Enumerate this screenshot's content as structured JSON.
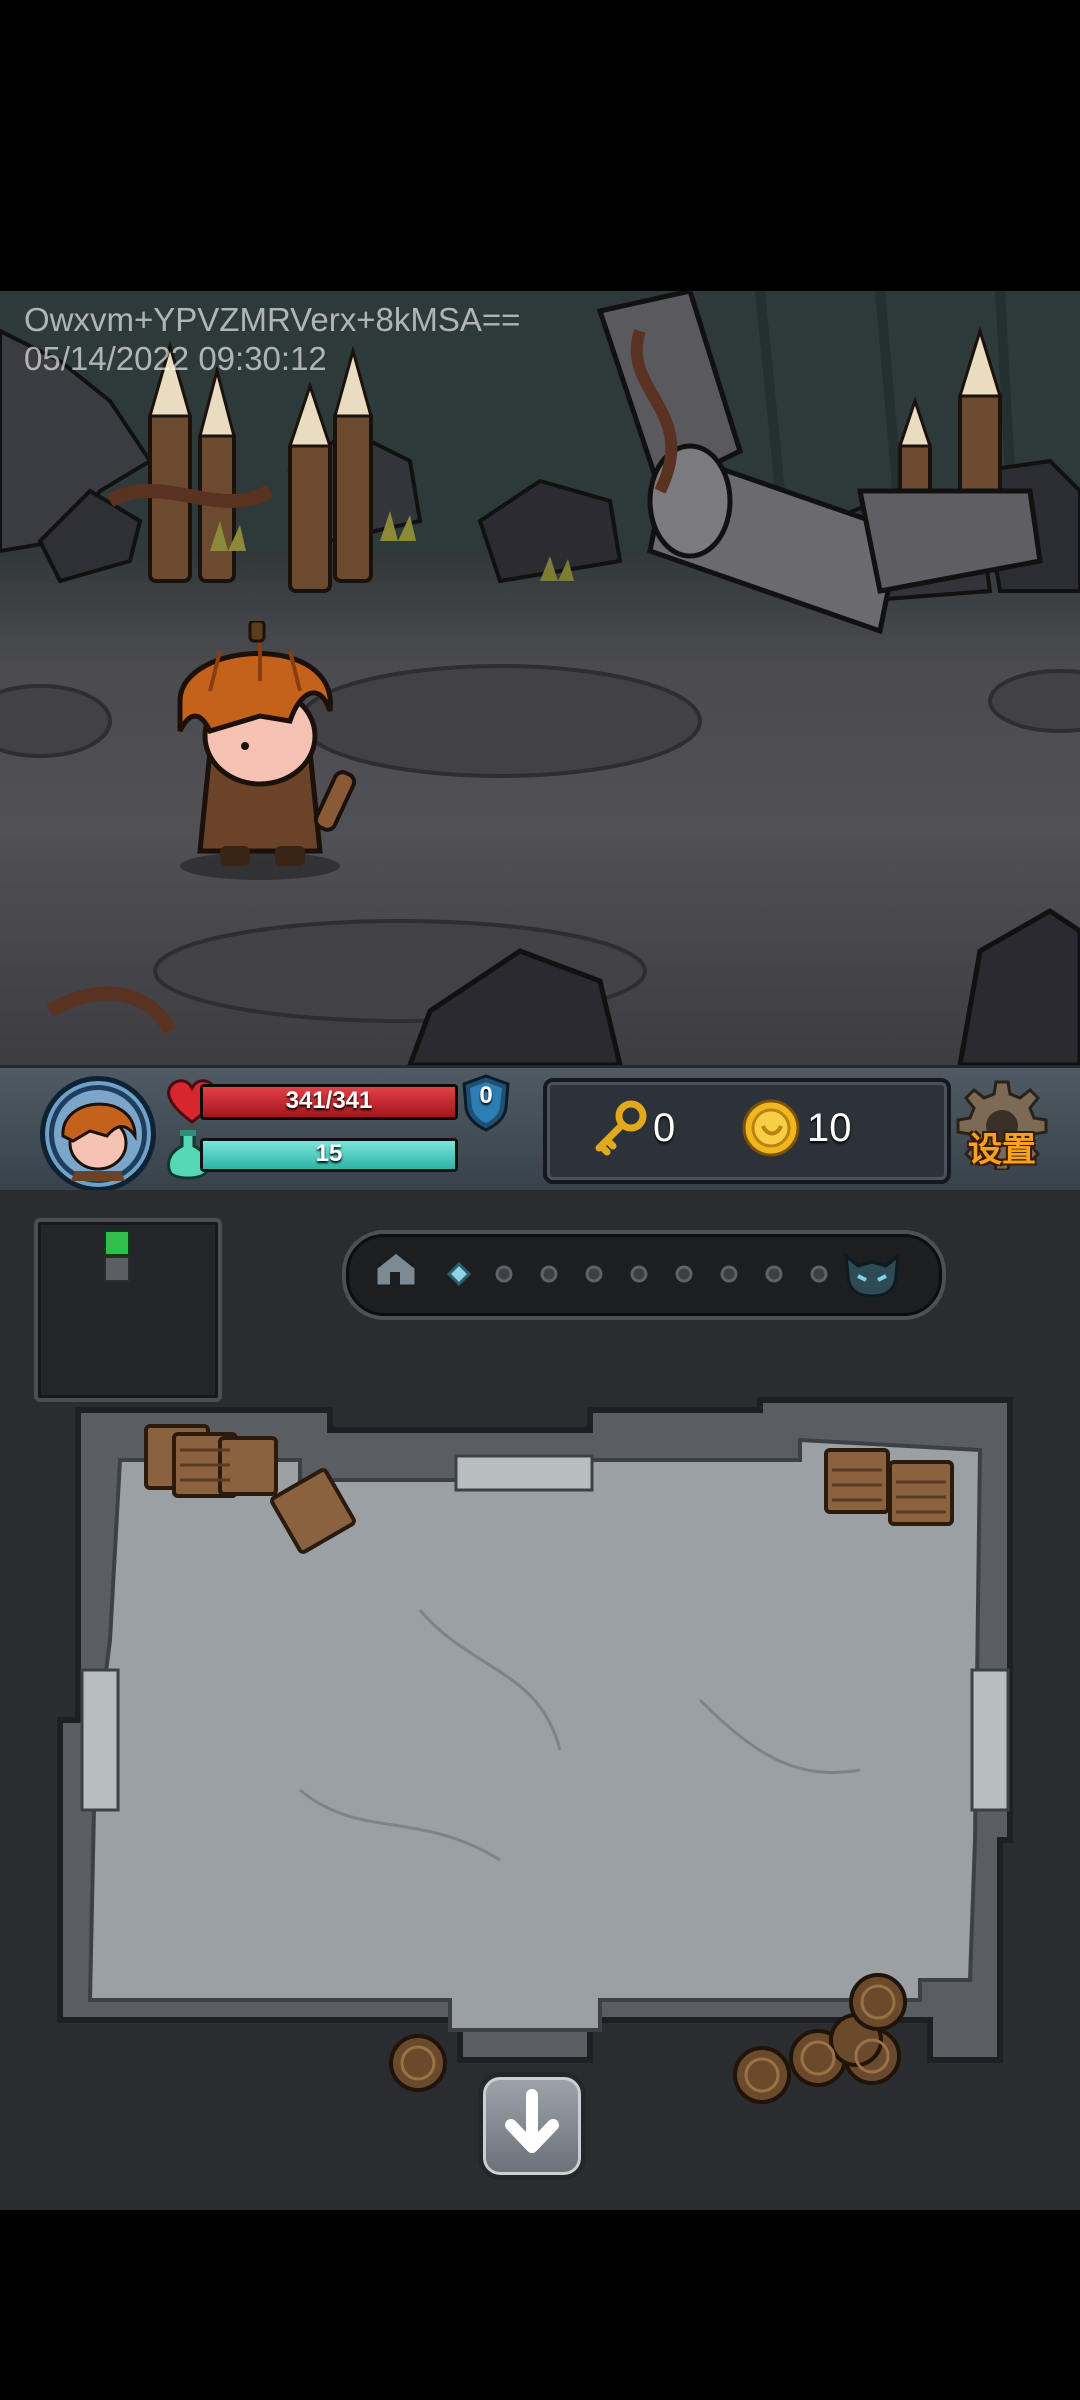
{
  "watermark": {
    "line1": "Owxvm+YPVZMRVerx+8kMSA==",
    "line2": "05/14/2022 09:30:12"
  },
  "hud": {
    "hp": "341/341",
    "mana": "15",
    "shield": "0",
    "keys": "0",
    "coins": "10",
    "settings_label": "设置",
    "hp_fill": 1.0,
    "mana_fill": 1.0
  },
  "progress": {
    "total_nodes": 9,
    "current_index": 0
  },
  "colors": {
    "hp": "#c7232a",
    "mana": "#4fd1c5",
    "gold": "#e0a417",
    "minimap_current": "#2fbf4a"
  }
}
